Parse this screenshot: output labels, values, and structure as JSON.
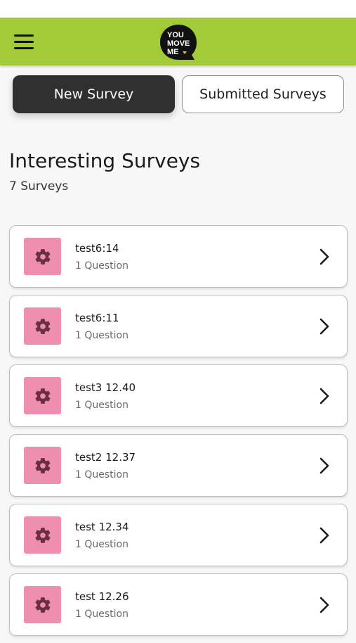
{
  "app": {
    "logo_text": [
      "YOU",
      "MOVE",
      "ME"
    ],
    "brand_color": "#a3cb38"
  },
  "header": {
    "menu_icon": "hamburger-menu-icon"
  },
  "tabs": [
    {
      "label": "New Survey",
      "active": true
    },
    {
      "label": "Submitted Surveys",
      "active": false
    }
  ],
  "section": {
    "title": "Interesting Surveys",
    "count_label": "7 Surveys"
  },
  "surveys": [
    {
      "title": "test6:14",
      "subtitle": "1 Question",
      "icon": "gear-icon"
    },
    {
      "title": "test6:11",
      "subtitle": "1 Question",
      "icon": "gear-icon"
    },
    {
      "title": "test3 12.40",
      "subtitle": "1 Question",
      "icon": "gear-icon"
    },
    {
      "title": "test2 12.37",
      "subtitle": "1 Question",
      "icon": "gear-icon"
    },
    {
      "title": "test 12.34",
      "subtitle": "1 Question",
      "icon": "gear-icon"
    },
    {
      "title": "test 12.26",
      "subtitle": "1 Question",
      "icon": "gear-icon"
    }
  ]
}
